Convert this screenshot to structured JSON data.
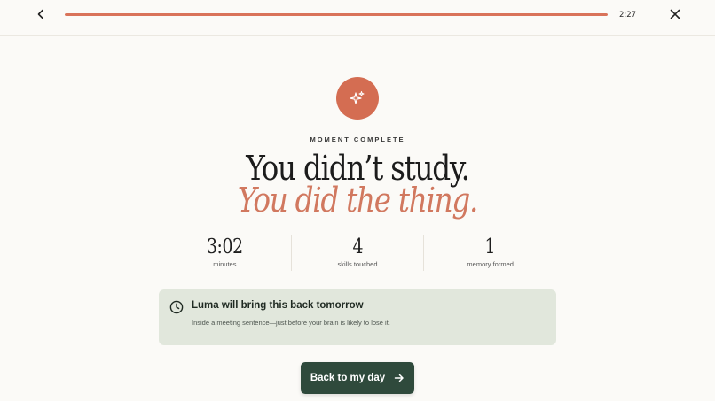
{
  "header": {
    "timer": "2:27",
    "progress_fraction": 1.0
  },
  "hero": {
    "eyebrow": "MOMENT COMPLETE",
    "headline": "You didn’t study.",
    "headline_accent": "You did the thing."
  },
  "stats": [
    {
      "value": "3:02",
      "label": "minutes"
    },
    {
      "value": "4",
      "label": "skills touched"
    },
    {
      "value": "1",
      "label": "memory formed"
    }
  ],
  "reminder": {
    "title": "Luma will bring this back tomorrow",
    "subtitle": "Inside a meeting sentence—just before your brain is likely to lose it."
  },
  "cta": {
    "label": "Back to my day"
  },
  "colors": {
    "accent": "#d46d52",
    "accent_text": "#d1785f",
    "card_bg": "#e1e7dc",
    "cta_bg": "#2f4a3c",
    "page_bg": "#fbfaf7"
  },
  "icons": {
    "back": "chevron-left-icon",
    "close": "close-icon",
    "badge": "sparkles-icon",
    "reminder": "clock-icon",
    "cta": "arrow-right-icon"
  }
}
